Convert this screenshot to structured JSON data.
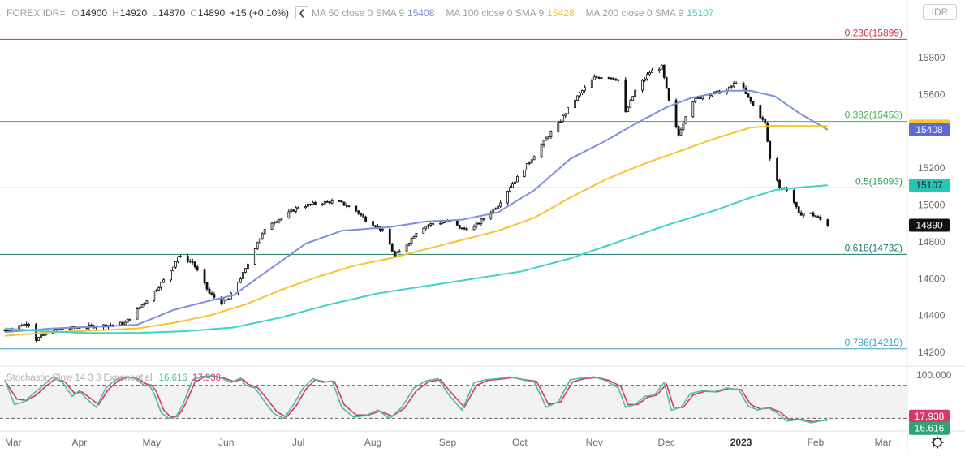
{
  "header": {
    "symbol": "FOREX IDR=",
    "open_label": "O",
    "open": "14900",
    "high_label": "H",
    "high": "14920",
    "low_label": "L",
    "low": "14870",
    "close_label": "C",
    "close": "14890",
    "change": "+15 (+0.10%)",
    "collapse_icon": "chevron-left-icon",
    "ma50_label": "MA 50 close 0 SMA 9",
    "ma50_value": "15408",
    "ma50_color": "#7f8fe0",
    "ma100_label": "MA 100 close 0 SMA 9",
    "ma100_value": "15428",
    "ma100_color": "#f5c431",
    "ma200_label": "MA 200 close 0 SMA 9",
    "ma200_value": "15107",
    "ma200_color": "#3ed3c6"
  },
  "symbol_box": {
    "label": "IDR"
  },
  "price_axis": {
    "ticks": [
      "15800",
      "15600",
      "15400",
      "15200",
      "15000",
      "14800",
      "14600",
      "14400",
      "14200"
    ],
    "tick_values": [
      15800,
      15600,
      15400,
      15200,
      15000,
      14800,
      14600,
      14400,
      14200
    ],
    "range": [
      14130,
      15980
    ],
    "badges": [
      {
        "label": "15428",
        "value": 15428,
        "bg": "#f5c431",
        "fg": "#222222"
      },
      {
        "label": "15408",
        "value": 15408,
        "bg": "#5c6ad8",
        "fg": "#ffffff"
      },
      {
        "label": "15107",
        "value": 15107,
        "bg": "#26c6b6",
        "fg": "#222222"
      },
      {
        "label": "14890",
        "value": 14890,
        "bg": "#111111",
        "fg": "#ffffff"
      }
    ]
  },
  "fib_levels": [
    {
      "label": "0.236(15899)",
      "value": 15899,
      "color": "#d2324b"
    },
    {
      "label": "0.382(15453)",
      "value": 15453,
      "color": "#4caf50"
    },
    {
      "label": "0.5(15093)",
      "value": 15093,
      "color": "#2e9e57"
    },
    {
      "label": "0.618(14732)",
      "value": 14732,
      "color": "#1b7a6a"
    },
    {
      "label": "0.786(14219)",
      "value": 14219,
      "color": "#3ba3c9"
    }
  ],
  "time_axis": {
    "labels": [
      "Mar",
      "Apr",
      "May",
      "Jun",
      "Jul",
      "Aug",
      "Sep",
      "Oct",
      "Nov",
      "Dec",
      "2023",
      "Feb",
      "Mar"
    ],
    "label_days": [
      0,
      31,
      61,
      92,
      122,
      153,
      184,
      214,
      245,
      275,
      306,
      337,
      365
    ],
    "bold_labels": [
      "2023"
    ]
  },
  "stochastic": {
    "label": "Stochastic Slow 14 3 3 Exponential",
    "k_value": "16.616",
    "d_value": "17.938",
    "k_color": "#4cc08f",
    "d_color": "#d23a6a",
    "upper_level": "100.000",
    "upper_value": 100,
    "upper_band": 80,
    "lower_band": 20,
    "range": [
      0,
      100
    ],
    "badges": [
      {
        "label": "17.938",
        "value": 17.938,
        "bg": "#d23a6a",
        "fg": "#ffffff"
      },
      {
        "label": "16.616",
        "value": 16.616,
        "bg": "#2fa374",
        "fg": "#ffffff"
      }
    ]
  },
  "chart_data": {
    "type": "candlestick",
    "title": "FOREX IDR=",
    "x_unit": "days from 2022-03-01",
    "ylim": [
      14130,
      15980
    ],
    "price_anchors": [
      [
        0,
        14320
      ],
      [
        10,
        14360
      ],
      [
        13,
        14270
      ],
      [
        18,
        14310
      ],
      [
        25,
        14330
      ],
      [
        35,
        14340
      ],
      [
        45,
        14350
      ],
      [
        50,
        14360
      ],
      [
        55,
        14430
      ],
      [
        60,
        14500
      ],
      [
        68,
        14620
      ],
      [
        72,
        14720
      ],
      [
        78,
        14690
      ],
      [
        85,
        14520
      ],
      [
        90,
        14470
      ],
      [
        93,
        14490
      ],
      [
        100,
        14650
      ],
      [
        105,
        14800
      ],
      [
        110,
        14900
      ],
      [
        115,
        14930
      ],
      [
        122,
        14990
      ],
      [
        130,
        15010
      ],
      [
        138,
        15020
      ],
      [
        145,
        14980
      ],
      [
        150,
        14920
      ],
      [
        155,
        14880
      ],
      [
        158,
        14850
      ],
      [
        162,
        14720
      ],
      [
        168,
        14800
      ],
      [
        172,
        14870
      ],
      [
        178,
        14900
      ],
      [
        185,
        14910
      ],
      [
        190,
        14870
      ],
      [
        195,
        14880
      ],
      [
        200,
        14940
      ],
      [
        205,
        15000
      ],
      [
        210,
        15100
      ],
      [
        215,
        15180
      ],
      [
        220,
        15270
      ],
      [
        225,
        15360
      ],
      [
        230,
        15440
      ],
      [
        235,
        15540
      ],
      [
        240,
        15620
      ],
      [
        245,
        15690
      ],
      [
        250,
        15700
      ],
      [
        255,
        15680
      ],
      [
        258,
        15500
      ],
      [
        262,
        15620
      ],
      [
        268,
        15720
      ],
      [
        273,
        15750
      ],
      [
        277,
        15500
      ],
      [
        280,
        15380
      ],
      [
        285,
        15560
      ],
      [
        292,
        15600
      ],
      [
        300,
        15620
      ],
      [
        305,
        15680
      ],
      [
        308,
        15600
      ],
      [
        312,
        15520
      ],
      [
        316,
        15440
      ],
      [
        318,
        15250
      ],
      [
        322,
        15100
      ],
      [
        326,
        15080
      ],
      [
        330,
        14950
      ],
      [
        334,
        14960
      ],
      [
        338,
        14930
      ],
      [
        342,
        14890
      ]
    ],
    "ma_series": [
      {
        "name": "MA 50 close 0 SMA 9",
        "color": "#7f8fe0",
        "points": [
          [
            0,
            14310
          ],
          [
            20,
            14330
          ],
          [
            40,
            14340
          ],
          [
            55,
            14350
          ],
          [
            70,
            14430
          ],
          [
            85,
            14480
          ],
          [
            95,
            14510
          ],
          [
            110,
            14650
          ],
          [
            125,
            14790
          ],
          [
            140,
            14860
          ],
          [
            150,
            14870
          ],
          [
            160,
            14880
          ],
          [
            175,
            14910
          ],
          [
            190,
            14920
          ],
          [
            205,
            14960
          ],
          [
            220,
            15080
          ],
          [
            235,
            15250
          ],
          [
            250,
            15350
          ],
          [
            262,
            15440
          ],
          [
            275,
            15530
          ],
          [
            285,
            15580
          ],
          [
            300,
            15620
          ],
          [
            310,
            15620
          ],
          [
            320,
            15590
          ],
          [
            330,
            15500
          ],
          [
            342,
            15408
          ]
        ]
      },
      {
        "name": "MA 100 close 0 SMA 9",
        "color": "#f5c431",
        "points": [
          [
            0,
            14290
          ],
          [
            20,
            14310
          ],
          [
            40,
            14320
          ],
          [
            55,
            14330
          ],
          [
            70,
            14360
          ],
          [
            85,
            14400
          ],
          [
            100,
            14460
          ],
          [
            115,
            14540
          ],
          [
            130,
            14610
          ],
          [
            145,
            14670
          ],
          [
            160,
            14710
          ],
          [
            175,
            14760
          ],
          [
            190,
            14810
          ],
          [
            205,
            14860
          ],
          [
            220,
            14930
          ],
          [
            235,
            15040
          ],
          [
            250,
            15140
          ],
          [
            265,
            15220
          ],
          [
            280,
            15290
          ],
          [
            295,
            15360
          ],
          [
            310,
            15420
          ],
          [
            320,
            15430
          ],
          [
            330,
            15428
          ],
          [
            342,
            15428
          ]
        ]
      },
      {
        "name": "MA 200 close 0 SMA 9",
        "color": "#3ed3c6",
        "points": [
          [
            0,
            14330
          ],
          [
            15,
            14315
          ],
          [
            35,
            14305
          ],
          [
            55,
            14305
          ],
          [
            75,
            14315
          ],
          [
            95,
            14335
          ],
          [
            115,
            14390
          ],
          [
            135,
            14460
          ],
          [
            155,
            14520
          ],
          [
            175,
            14560
          ],
          [
            195,
            14600
          ],
          [
            215,
            14640
          ],
          [
            235,
            14710
          ],
          [
            255,
            14800
          ],
          [
            275,
            14890
          ],
          [
            295,
            14970
          ],
          [
            310,
            15040
          ],
          [
            320,
            15080
          ],
          [
            330,
            15095
          ],
          [
            342,
            15107
          ]
        ]
      }
    ],
    "stochastic": {
      "range": [
        0,
        100
      ],
      "k_anchors": [
        [
          0,
          90
        ],
        [
          4,
          45
        ],
        [
          8,
          50
        ],
        [
          12,
          65
        ],
        [
          16,
          80
        ],
        [
          20,
          95
        ],
        [
          24,
          85
        ],
        [
          28,
          60
        ],
        [
          31,
          70
        ],
        [
          34,
          55
        ],
        [
          38,
          40
        ],
        [
          42,
          75
        ],
        [
          46,
          90
        ],
        [
          50,
          95
        ],
        [
          54,
          92
        ],
        [
          58,
          80
        ],
        [
          60,
          80
        ],
        [
          62,
          65
        ],
        [
          65,
          30
        ],
        [
          68,
          20
        ],
        [
          71,
          22
        ],
        [
          74,
          45
        ],
        [
          78,
          90
        ],
        [
          82,
          96
        ],
        [
          86,
          97
        ],
        [
          90,
          93
        ],
        [
          94,
          85
        ],
        [
          98,
          93
        ],
        [
          100,
          80
        ],
        [
          104,
          75
        ],
        [
          108,
          50
        ],
        [
          112,
          28
        ],
        [
          116,
          20
        ],
        [
          120,
          45
        ],
        [
          124,
          75
        ],
        [
          128,
          92
        ],
        [
          132,
          85
        ],
        [
          136,
          88
        ],
        [
          140,
          40
        ],
        [
          145,
          22
        ],
        [
          150,
          25
        ],
        [
          155,
          35
        ],
        [
          160,
          20
        ],
        [
          165,
          40
        ],
        [
          170,
          75
        ],
        [
          175,
          88
        ],
        [
          180,
          92
        ],
        [
          185,
          60
        ],
        [
          190,
          35
        ],
        [
          195,
          85
        ],
        [
          200,
          90
        ],
        [
          205,
          92
        ],
        [
          210,
          95
        ],
        [
          215,
          90
        ],
        [
          220,
          86
        ],
        [
          225,
          40
        ],
        [
          230,
          50
        ],
        [
          235,
          90
        ],
        [
          240,
          93
        ],
        [
          245,
          95
        ],
        [
          250,
          88
        ],
        [
          255,
          75
        ],
        [
          258,
          40
        ],
        [
          262,
          45
        ],
        [
          266,
          60
        ],
        [
          270,
          62
        ],
        [
          274,
          85
        ],
        [
          277,
          35
        ],
        [
          281,
          40
        ],
        [
          285,
          65
        ],
        [
          290,
          70
        ],
        [
          295,
          68
        ],
        [
          300,
          75
        ],
        [
          305,
          72
        ],
        [
          309,
          42
        ],
        [
          313,
          35
        ],
        [
          317,
          40
        ],
        [
          321,
          30
        ],
        [
          325,
          15
        ],
        [
          330,
          18
        ],
        [
          335,
          12
        ],
        [
          340,
          16
        ],
        [
          342,
          16.616
        ]
      ],
      "d_anchors": [
        [
          0,
          88
        ],
        [
          5,
          55
        ],
        [
          9,
          52
        ],
        [
          13,
          62
        ],
        [
          17,
          78
        ],
        [
          21,
          92
        ],
        [
          25,
          86
        ],
        [
          29,
          65
        ],
        [
          32,
          68
        ],
        [
          35,
          58
        ],
        [
          39,
          45
        ],
        [
          43,
          72
        ],
        [
          47,
          88
        ],
        [
          51,
          94
        ],
        [
          55,
          92
        ],
        [
          59,
          82
        ],
        [
          61,
          80
        ],
        [
          63,
          68
        ],
        [
          66,
          35
        ],
        [
          69,
          22
        ],
        [
          72,
          24
        ],
        [
          75,
          45
        ],
        [
          79,
          86
        ],
        [
          83,
          95
        ],
        [
          87,
          96
        ],
        [
          91,
          93
        ],
        [
          95,
          87
        ],
        [
          99,
          91
        ],
        [
          101,
          82
        ],
        [
          105,
          76
        ],
        [
          109,
          55
        ],
        [
          113,
          32
        ],
        [
          117,
          22
        ],
        [
          121,
          42
        ],
        [
          125,
          72
        ],
        [
          129,
          90
        ],
        [
          133,
          86
        ],
        [
          137,
          87
        ],
        [
          141,
          45
        ],
        [
          146,
          26
        ],
        [
          151,
          26
        ],
        [
          156,
          33
        ],
        [
          161,
          24
        ],
        [
          166,
          38
        ],
        [
          171,
          70
        ],
        [
          176,
          86
        ],
        [
          181,
          90
        ],
        [
          186,
          64
        ],
        [
          191,
          40
        ],
        [
          196,
          80
        ],
        [
          201,
          89
        ],
        [
          206,
          91
        ],
        [
          211,
          94
        ],
        [
          216,
          90
        ],
        [
          221,
          87
        ],
        [
          226,
          45
        ],
        [
          231,
          50
        ],
        [
          236,
          86
        ],
        [
          241,
          92
        ],
        [
          246,
          94
        ],
        [
          251,
          89
        ],
        [
          256,
          78
        ],
        [
          259,
          45
        ],
        [
          263,
          45
        ],
        [
          267,
          58
        ],
        [
          271,
          62
        ],
        [
          275,
          82
        ],
        [
          278,
          40
        ],
        [
          282,
          40
        ],
        [
          286,
          62
        ],
        [
          291,
          69
        ],
        [
          296,
          68
        ],
        [
          301,
          74
        ],
        [
          306,
          72
        ],
        [
          310,
          45
        ],
        [
          314,
          37
        ],
        [
          318,
          39
        ],
        [
          322,
          32
        ],
        [
          326,
          18
        ],
        [
          331,
          18
        ],
        [
          336,
          14
        ],
        [
          341,
          17
        ],
        [
          342,
          17.938
        ]
      ]
    }
  }
}
